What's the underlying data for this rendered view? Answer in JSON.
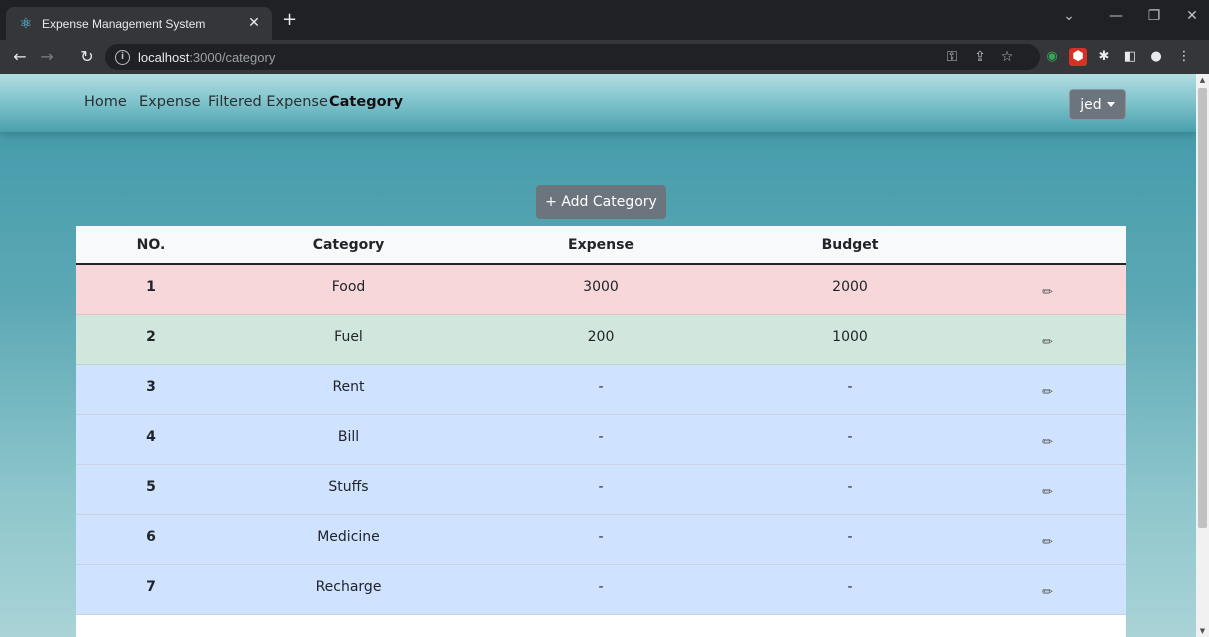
{
  "browser": {
    "tab_title": "Expense Management System",
    "url_host": "localhost",
    "url_path": ":3000/category"
  },
  "navbar": {
    "links": [
      "Home",
      "Expense",
      "Filtered Expense",
      "Category"
    ],
    "active": "Category",
    "user": "jed"
  },
  "add_button": "+ Add Category",
  "table": {
    "headers": [
      "NO.",
      "Category",
      "Expense",
      "Budget",
      ""
    ],
    "rows": [
      {
        "no": "1",
        "category": "Food",
        "expense": "3000",
        "budget": "2000",
        "status": "danger"
      },
      {
        "no": "2",
        "category": "Fuel",
        "expense": "200",
        "budget": "1000",
        "status": "success"
      },
      {
        "no": "3",
        "category": "Rent",
        "expense": "-",
        "budget": "-",
        "status": "primary"
      },
      {
        "no": "4",
        "category": "Bill",
        "expense": "-",
        "budget": "-",
        "status": "primary"
      },
      {
        "no": "5",
        "category": "Stuffs",
        "expense": "-",
        "budget": "-",
        "status": "primary"
      },
      {
        "no": "6",
        "category": "Medicine",
        "expense": "-",
        "budget": "-",
        "status": "primary"
      },
      {
        "no": "7",
        "category": "Recharge",
        "expense": "-",
        "budget": "-",
        "status": "primary"
      }
    ],
    "row_colors": {
      "danger": "#f8d7da",
      "success": "#d1e7dd",
      "primary": "#cfe2ff"
    }
  }
}
